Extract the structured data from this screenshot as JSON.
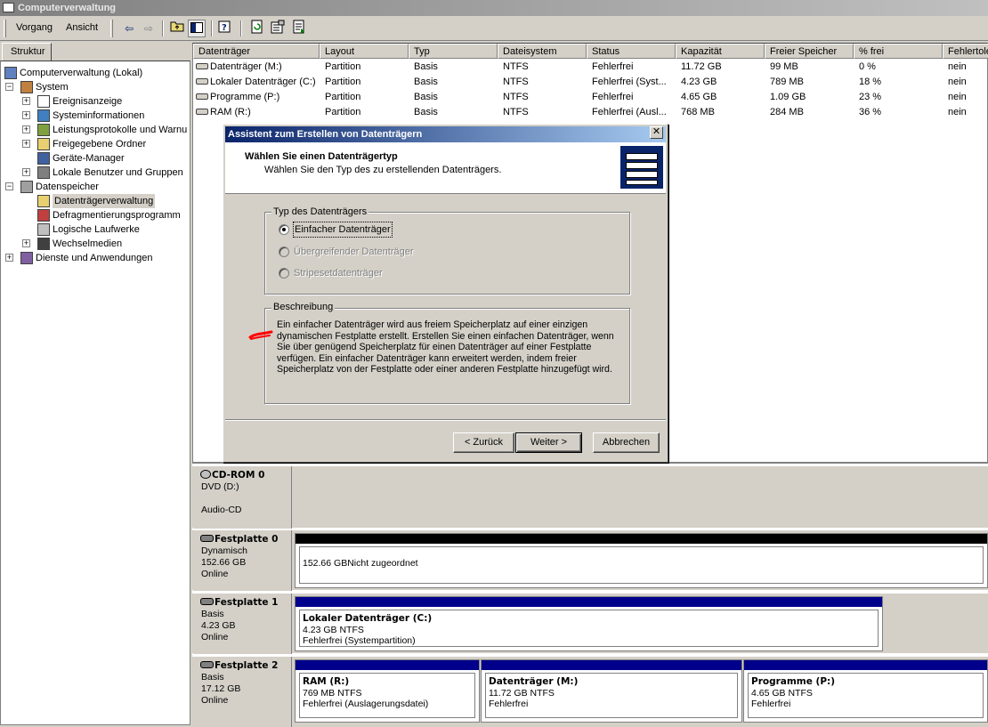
{
  "window": {
    "title": "Computerverwaltung"
  },
  "menu": {
    "items": [
      "Vorgang",
      "Ansicht"
    ]
  },
  "toolbar": {
    "icons": [
      "back-arrow-icon",
      "forward-arrow-icon",
      "up-folder-icon",
      "show-hide-tree-icon",
      "help-icon",
      "refresh-icon",
      "properties-icon",
      "export-list-icon"
    ]
  },
  "left_panel": {
    "tab": "Struktur",
    "tree": [
      {
        "label": "Computerverwaltung (Lokal)",
        "icon": "computer-icon",
        "level": 0,
        "expander": ""
      },
      {
        "label": "System",
        "icon": "system-tools-icon",
        "level": 1,
        "expander": "−"
      },
      {
        "label": "Ereignisanzeige",
        "icon": "event-viewer-icon",
        "level": 2,
        "expander": "+"
      },
      {
        "label": "Systeminformationen",
        "icon": "system-info-icon",
        "level": 2,
        "expander": "+"
      },
      {
        "label": "Leistungsprotokolle und Warnu",
        "icon": "performance-icon",
        "level": 2,
        "expander": "+"
      },
      {
        "label": "Freigegebene Ordner",
        "icon": "shared-folder-icon",
        "level": 2,
        "expander": "+"
      },
      {
        "label": "Geräte-Manager",
        "icon": "device-manager-icon",
        "level": 2,
        "expander": ""
      },
      {
        "label": "Lokale Benutzer und Gruppen",
        "icon": "users-icon",
        "level": 2,
        "expander": "+"
      },
      {
        "label": "Datenspeicher",
        "icon": "storage-icon",
        "level": 1,
        "expander": "−"
      },
      {
        "label": "Datenträgerverwaltung",
        "icon": "disk-management-icon",
        "level": 2,
        "expander": "",
        "selected": true
      },
      {
        "label": "Defragmentierungsprogramm",
        "icon": "defrag-icon",
        "level": 2,
        "expander": ""
      },
      {
        "label": "Logische Laufwerke",
        "icon": "logical-drive-icon",
        "level": 2,
        "expander": ""
      },
      {
        "label": "Wechselmedien",
        "icon": "removable-media-icon",
        "level": 2,
        "expander": "+"
      },
      {
        "label": "Dienste und Anwendungen",
        "icon": "services-icon",
        "level": 1,
        "expander": "+"
      }
    ]
  },
  "volume_list": {
    "columns": [
      "Datenträger",
      "Layout",
      "Typ",
      "Dateisystem",
      "Status",
      "Kapazität",
      "Freier Speicher",
      "% frei",
      "Fehlertole"
    ],
    "rows": [
      [
        "Datenträger (M:)",
        "Partition",
        "Basis",
        "NTFS",
        "Fehlerfrei",
        "11.72 GB",
        "99 MB",
        "0 %",
        "nein"
      ],
      [
        "Lokaler Datenträger (C:)",
        "Partition",
        "Basis",
        "NTFS",
        "Fehlerfrei (Syst...",
        "4.23 GB",
        "789 MB",
        "18 %",
        "nein"
      ],
      [
        "Programme (P:)",
        "Partition",
        "Basis",
        "NTFS",
        "Fehlerfrei",
        "4.65 GB",
        "1.09 GB",
        "23 %",
        "nein"
      ],
      [
        "RAM (R:)",
        "Partition",
        "Basis",
        "NTFS",
        "Fehlerfrei (Ausl...",
        "768 MB",
        "284 MB",
        "36 %",
        "nein"
      ]
    ]
  },
  "dialog": {
    "title": "Assistent zum Erstellen von Datenträgern",
    "heading": "Wählen Sie einen Datenträgertyp",
    "subheading": "Wählen Sie den Typ des zu erstellenden Datenträgers.",
    "type_group": {
      "label": "Typ des Datenträgers",
      "options": [
        {
          "label": "Einfacher Datenträger",
          "selected": true,
          "enabled": true
        },
        {
          "label": "Übergreifender Datenträger",
          "selected": false,
          "enabled": false
        },
        {
          "label": "Stripesetdatenträger",
          "selected": false,
          "enabled": false
        }
      ]
    },
    "description_group": {
      "label": "Beschreibung",
      "text": "Ein einfacher Datenträger wird aus freiem Speicherplatz auf einer einzigen dynamischen Festplatte erstellt. Erstellen Sie einen einfachen Datenträger, wenn Sie über genügend Speicherplatz für einen Datenträger auf einer Festplatte verfügen. Ein einfacher Datenträger kann erweitert werden, indem freier Speicherplatz von der Festplatte oder einer anderen Festplatte hinzugefügt wird."
    },
    "buttons": {
      "back": "< Zurück",
      "next": "Weiter >",
      "cancel": "Abbrechen"
    }
  },
  "disks": [
    {
      "name": "CD-ROM 0",
      "lines": [
        "DVD (D:)",
        "",
        "Audio-CD"
      ],
      "partitions": []
    },
    {
      "name": "Festplatte 0",
      "lines": [
        "Dynamisch",
        "152.66 GB",
        "Online"
      ],
      "partitions": [
        {
          "title": "",
          "size": "152.66 GB",
          "status": "Nicht zugeordnet",
          "kind": "unallocated"
        }
      ]
    },
    {
      "name": "Festplatte 1",
      "lines": [
        "Basis",
        "4.23 GB",
        "Online"
      ],
      "partitions": [
        {
          "title": "Lokaler Datenträger  (C:)",
          "size": "4.23 GB NTFS",
          "status": "Fehlerfrei (Systempartition)",
          "kind": "primary"
        }
      ]
    },
    {
      "name": "Festplatte 2",
      "lines": [
        "Basis",
        "17.12 GB",
        "Online"
      ],
      "partitions": [
        {
          "title": "RAM  (R:)",
          "size": "769 MB NTFS",
          "status": "Fehlerfrei (Auslagerungsdatei)",
          "kind": "primary"
        },
        {
          "title": "Datenträger  (M:)",
          "size": "11.72 GB NTFS",
          "status": "Fehlerfrei",
          "kind": "primary"
        },
        {
          "title": "Programme  (P:)",
          "size": "4.65 GB NTFS",
          "status": "Fehlerfrei",
          "kind": "primary"
        }
      ]
    }
  ],
  "colors": {
    "primary_partition": "#00008b",
    "unallocated": "#000000",
    "dialog_title": "#0a246a",
    "annotation": "#ff0000"
  }
}
